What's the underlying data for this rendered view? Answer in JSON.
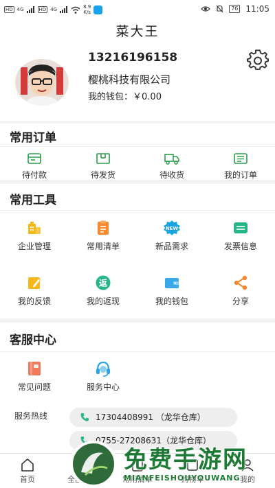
{
  "status_bar": {
    "tag1": "HD",
    "tag2": "HD",
    "net1": "4G",
    "net2": "4G",
    "speed_value": "8.9",
    "speed_unit": "K/s",
    "battery": "76",
    "time": "11:05"
  },
  "title": "菜大王",
  "profile": {
    "phone": "13216196158",
    "company": "樱桃科技有限公司",
    "wallet_label": "我的钱包：",
    "wallet_amount": "￥0.00"
  },
  "orders": {
    "title": "常用订单",
    "items": [
      {
        "label": "待付款",
        "icon": "wallet-card-icon"
      },
      {
        "label": "待发货",
        "icon": "package-icon"
      },
      {
        "label": "待收货",
        "icon": "truck-icon"
      },
      {
        "label": "我的订单",
        "icon": "order-list-icon"
      }
    ]
  },
  "tools": {
    "title": "常用工具",
    "items": [
      {
        "label": "企业管理",
        "icon": "enterprise-icon",
        "color": "#f5b818"
      },
      {
        "label": "常用清单",
        "icon": "clipboard-icon",
        "color": "#f58a2e"
      },
      {
        "label": "新品需求",
        "icon": "new-badge-icon",
        "color": "#1ba3e0"
      },
      {
        "label": "发票信息",
        "icon": "invoice-icon",
        "color": "#27b58a"
      },
      {
        "label": "我的反馈",
        "icon": "feedback-icon",
        "color": "#f5b818"
      },
      {
        "label": "我的返现",
        "icon": "cashback-icon",
        "color": "#27b58a"
      },
      {
        "label": "我的钱包",
        "icon": "wallet-icon",
        "color": "#3aa7e8"
      },
      {
        "label": "分享",
        "icon": "share-icon",
        "color": "#f5882e"
      }
    ],
    "cashback_glyph": "返",
    "new_text": "NEW"
  },
  "service": {
    "title": "客服中心",
    "items": [
      {
        "label": "常见问题",
        "icon": "faq-book-icon",
        "color": "#f07a5a"
      },
      {
        "label": "服务中心",
        "icon": "headset-icon",
        "color": "#2aa6e8"
      }
    ],
    "hotline_label": "服务热线",
    "hotlines": [
      "17304408991 （龙华仓库）",
      "0755-27208631（龙华仓库）"
    ]
  },
  "tabbar": {
    "items": [
      "首页",
      "全部菜品",
      "常用清单",
      "购物车",
      "我的"
    ]
  },
  "watermark": {
    "text": "免费手游网",
    "sub": "MIANFEISHOUYOUWANG"
  }
}
